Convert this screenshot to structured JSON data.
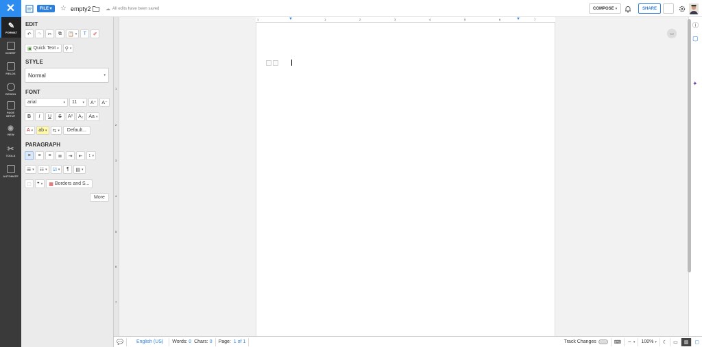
{
  "topbar": {
    "file_label": "FILE",
    "doc_name": "empty2",
    "saved_status": "All edits have been saved",
    "compose_label": "COMPOSE",
    "share_label": "SHARE"
  },
  "leftnav": {
    "items": [
      {
        "label": "FORMAT"
      },
      {
        "label": "INSERT"
      },
      {
        "label": "FIELDS"
      },
      {
        "label": "DESIGN"
      },
      {
        "label": "PAGE SETUP"
      },
      {
        "label": "VIEW"
      },
      {
        "label": "TOOLS"
      },
      {
        "label": "AUTOMATE"
      }
    ]
  },
  "panel": {
    "edit_heading": "EDIT",
    "quick_text": "Quick Text",
    "style_heading": "STYLE",
    "style_value": "Normal",
    "font_heading": "FONT",
    "font_family": "arial",
    "font_size": "11",
    "default_label": "Default...",
    "paragraph_heading": "PARAGRAPH",
    "borders_label": "Borders and S...",
    "more_label": "More"
  },
  "ruler": {
    "h_ticks": [
      "1",
      "1",
      "2",
      "3",
      "4",
      "5",
      "6",
      "7"
    ],
    "v_ticks": [
      "1",
      "2",
      "3",
      "4",
      "5",
      "6",
      "7"
    ]
  },
  "status": {
    "language": "English (US)",
    "words_label": "Words:",
    "words_value": "0",
    "chars_label": "Chars:",
    "chars_value": "0",
    "page_label": "Page:",
    "page_current": "1",
    "page_total": "of 1",
    "track_changes": "Track Changes",
    "zoom": "100%"
  },
  "colors": {
    "accent": "#2d8cf0",
    "nav_bg": "#3a3a3a"
  }
}
